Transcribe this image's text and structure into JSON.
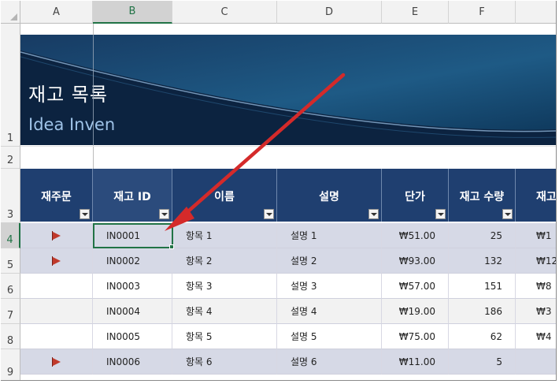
{
  "columns": [
    "A",
    "B",
    "C",
    "D",
    "E",
    "F"
  ],
  "rows": [
    "1",
    "2",
    "3",
    "4",
    "5",
    "6",
    "7",
    "8",
    "9"
  ],
  "banner": {
    "title": "재고 목록",
    "subtitle": "Idea Inven"
  },
  "table": {
    "headers": [
      "재주문",
      "재고 ID",
      "이름",
      "설명",
      "단가",
      "재고 수량",
      "재고"
    ],
    "rows": [
      {
        "reorder": true,
        "id": "IN0001",
        "name": "항목 1",
        "desc": "설명 1",
        "price": "₩51.00",
        "qty": "25",
        "value": "₩1"
      },
      {
        "reorder": true,
        "id": "IN0002",
        "name": "항목 2",
        "desc": "설명 2",
        "price": "₩93.00",
        "qty": "132",
        "value": "₩12"
      },
      {
        "reorder": false,
        "id": "IN0003",
        "name": "항목 3",
        "desc": "설명 3",
        "price": "₩57.00",
        "qty": "151",
        "value": "₩8"
      },
      {
        "reorder": false,
        "id": "IN0004",
        "name": "항목 4",
        "desc": "설명 4",
        "price": "₩19.00",
        "qty": "186",
        "value": "₩3"
      },
      {
        "reorder": false,
        "id": "IN0005",
        "name": "항목 5",
        "desc": "설명 5",
        "price": "₩75.00",
        "qty": "62",
        "value": "₩4"
      },
      {
        "reorder": true,
        "id": "IN0006",
        "name": "항목 6",
        "desc": "설명 6",
        "price": "₩11.00",
        "qty": "5",
        "value": ""
      }
    ]
  },
  "selected_cell": "B4",
  "colors": {
    "header_fill": "#1f3f70",
    "highlight_row": "#d6d9e6",
    "selection": "#217346",
    "flag": "#c0392b",
    "arrow": "#d42a2a"
  },
  "icons": [
    "filter-dropdown-icon",
    "reorder-flag-icon",
    "pointer-arrow"
  ]
}
